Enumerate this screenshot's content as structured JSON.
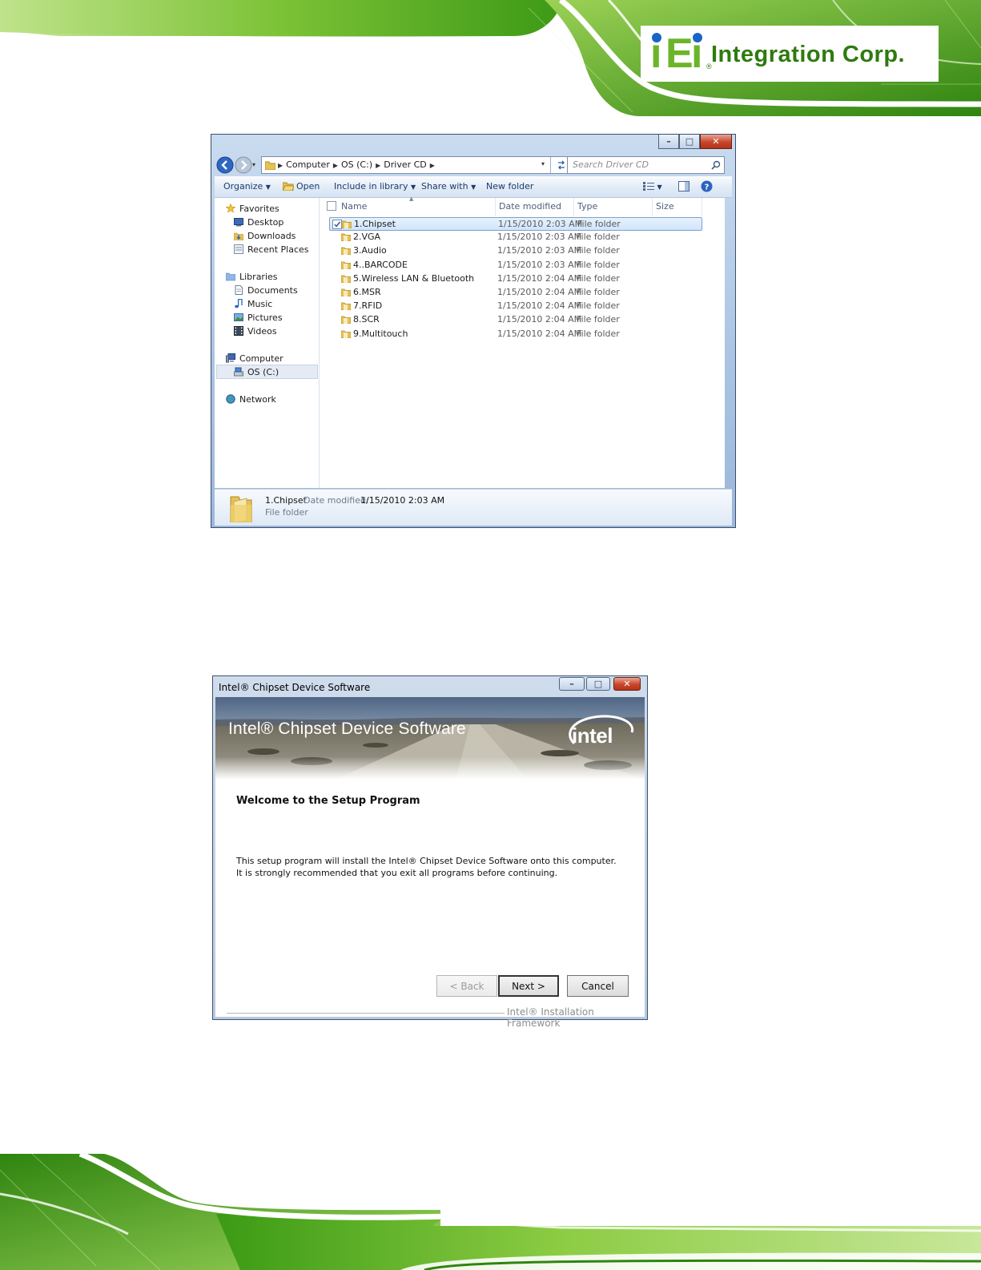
{
  "header": {
    "brand": {
      "name": "Integration Corp.",
      "colors": {
        "green": "#6cb52a",
        "dark_green": "#2f7a0f",
        "blue": "#1a64c8"
      }
    }
  },
  "explorer": {
    "address": {
      "segments": [
        "Computer",
        "OS (C:)",
        "Driver CD"
      ]
    },
    "search": {
      "placeholder": "Search Driver CD"
    },
    "toolbar": {
      "organize": "Organize",
      "open": "Open",
      "include_in_library": "Include in library",
      "share_with": "Share with",
      "new_folder": "New folder"
    },
    "nav": {
      "favorites": "Favorites",
      "desktop": "Desktop",
      "downloads": "Downloads",
      "recent_places": "Recent Places",
      "libraries": "Libraries",
      "documents": "Documents",
      "music": "Music",
      "pictures": "Pictures",
      "videos": "Videos",
      "computer": "Computer",
      "os_c": "OS (C:)",
      "network": "Network"
    },
    "columns": {
      "name": "Name",
      "date_modified": "Date modified",
      "type": "Type",
      "size": "Size"
    },
    "files": [
      {
        "name": "1.Chipset",
        "date": "1/15/2010 2:03 AM",
        "type": "File folder"
      },
      {
        "name": "2.VGA",
        "date": "1/15/2010 2:03 AM",
        "type": "File folder"
      },
      {
        "name": "3.Audio",
        "date": "1/15/2010 2:03 AM",
        "type": "File folder"
      },
      {
        "name": "4..BARCODE",
        "date": "1/15/2010 2:03 AM",
        "type": "File folder"
      },
      {
        "name": "5.Wireless LAN & Bluetooth",
        "date": "1/15/2010 2:04 AM",
        "type": "File folder"
      },
      {
        "name": "6.MSR",
        "date": "1/15/2010 2:04 AM",
        "type": "File folder"
      },
      {
        "name": "7.RFID",
        "date": "1/15/2010 2:04 AM",
        "type": "File folder"
      },
      {
        "name": "8.SCR",
        "date": "1/15/2010 2:04 AM",
        "type": "File folder"
      },
      {
        "name": "9.Multitouch",
        "date": "1/15/2010 2:04 AM",
        "type": "File folder"
      }
    ],
    "details": {
      "name": "1.Chipset",
      "date_label": "Date modified:",
      "date_value": "1/15/2010 2:03 AM",
      "type": "File folder"
    }
  },
  "installer": {
    "window_title": "Intel® Chipset Device Software",
    "banner_title": "Intel® Chipset Device Software",
    "logo": "intel",
    "heading": "Welcome to the Setup Program",
    "description": "This setup program will install the Intel® Chipset Device Software onto this computer. It is strongly recommended that you exit all programs before continuing.",
    "buttons": {
      "back": "< Back",
      "next": "Next >",
      "cancel": "Cancel"
    },
    "footer": "Intel® Installation Framework"
  }
}
